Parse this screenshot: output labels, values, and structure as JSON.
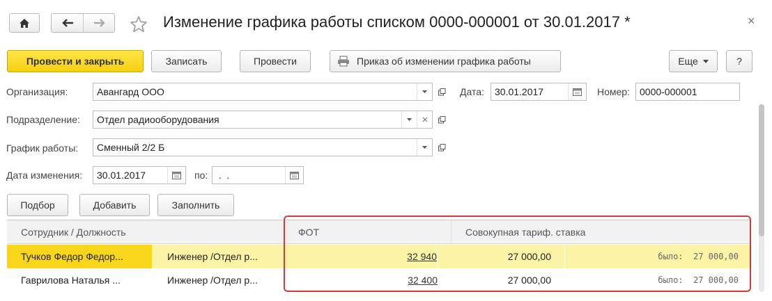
{
  "nav": {
    "title": "Изменение графика работы списком 0000-000001 от 30.01.2017 *",
    "close": "×"
  },
  "toolbar": {
    "post_close": "Провести и закрыть",
    "save": "Записать",
    "post": "Провести",
    "print_order": "Приказ об изменении графика работы",
    "more": "Еще",
    "help": "?"
  },
  "form": {
    "org_label": "Организация:",
    "org_value": "Авангард ООО",
    "date_label": "Дата:",
    "date_value": "30.01.2017",
    "number_label": "Номер:",
    "number_value": "0000-000001",
    "dept_label": "Подразделение:",
    "dept_value": "Отдел радиооборудования",
    "schedule_label": "График работы:",
    "schedule_value": "Сменный 2/2 Б",
    "change_date_label": "Дата изменения:",
    "change_date_value": "30.01.2017",
    "to_label": "по:",
    "to_value": " .  ."
  },
  "table_toolbar": {
    "select": "Подбор",
    "add": "Добавить",
    "fill": "Заполнить"
  },
  "table": {
    "headers": [
      "Сотрудник / Должность",
      "ФОТ",
      "Совокупная тариф. ставка"
    ],
    "rows": [
      {
        "employee": "Тучков Федор Федор...",
        "position": "Инженер /Отдел р...",
        "fot": "32 940",
        "rate": "27 000,00",
        "was": "было:  27 000,00"
      },
      {
        "employee": "Гаврилова Наталья ...",
        "position": "Инженер /Отдел р...",
        "fot": "32 400",
        "rate": "27 000,00",
        "was": "было:  27 000,00"
      }
    ]
  },
  "colors": {
    "primary_button": "#f5cf0e",
    "selected_row": "#fbf3a6",
    "selected_name_cell": "#f7d61c",
    "highlight_frame": "#d9383a"
  },
  "icons": [
    "home-icon",
    "arrow-left-icon",
    "arrow-right-icon",
    "star-icon",
    "printer-icon",
    "dropdown-arrow-icon",
    "open-icon",
    "clear-icon",
    "calendar-icon"
  ]
}
